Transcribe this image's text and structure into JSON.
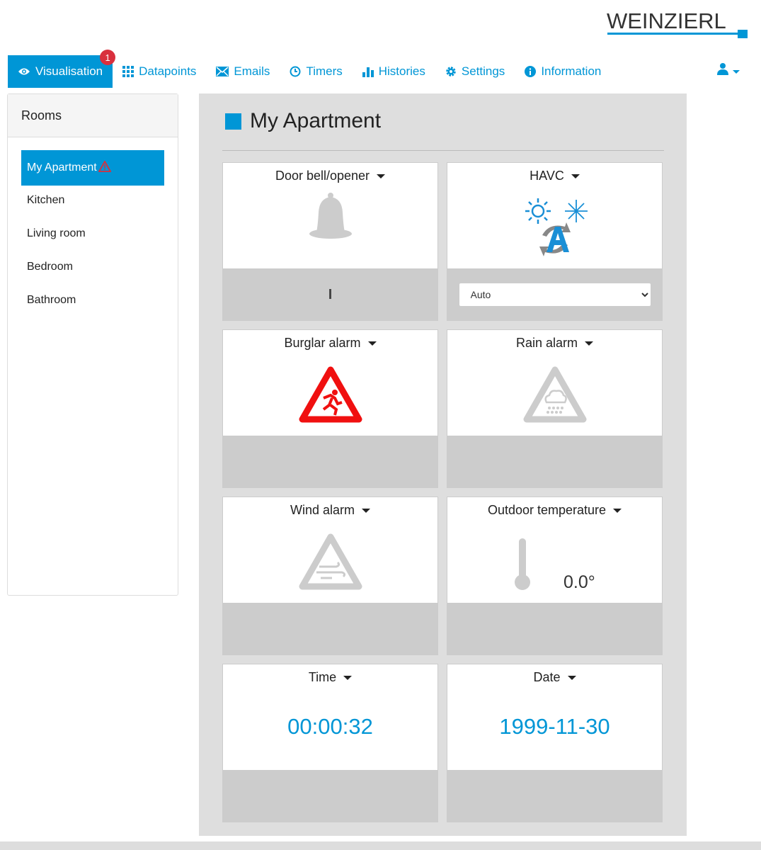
{
  "brand": {
    "logo": "WEINZIERL",
    "accent": "#0096d6"
  },
  "nav": {
    "items": [
      {
        "label": "Visualisation",
        "icon": "eye-icon",
        "active": true,
        "badge": "1"
      },
      {
        "label": "Datapoints",
        "icon": "grid-icon"
      },
      {
        "label": "Emails",
        "icon": "envelope-icon"
      },
      {
        "label": "Timers",
        "icon": "clock-icon"
      },
      {
        "label": "Histories",
        "icon": "bar-chart-icon"
      },
      {
        "label": "Settings",
        "icon": "gear-icon"
      },
      {
        "label": "Information",
        "icon": "info-icon"
      }
    ],
    "user_icon": "user-icon"
  },
  "sidebar": {
    "title": "Rooms",
    "rooms": [
      "My Apartment",
      "Kitchen",
      "Living room",
      "Bedroom",
      "Bathroom"
    ]
  },
  "main": {
    "title": "My Apartment",
    "cards": [
      {
        "title": "Door bell/opener",
        "icon": "bell-icon",
        "bottom": "I"
      },
      {
        "title": "HAVC",
        "icon": "hvac-auto-icon",
        "select": "Auto"
      },
      {
        "title": "Burglar alarm",
        "icon": "burglar-alarm-icon",
        "status": "active"
      },
      {
        "title": "Rain alarm",
        "icon": "rain-alarm-icon"
      },
      {
        "title": "Wind alarm",
        "icon": "wind-alarm-icon"
      },
      {
        "title": "Outdoor temperature",
        "icon": "thermometer-icon",
        "value": "0.0°"
      },
      {
        "title": "Time",
        "value": "00:00:32"
      },
      {
        "title": "Date",
        "value": "1999-11-30"
      }
    ]
  }
}
